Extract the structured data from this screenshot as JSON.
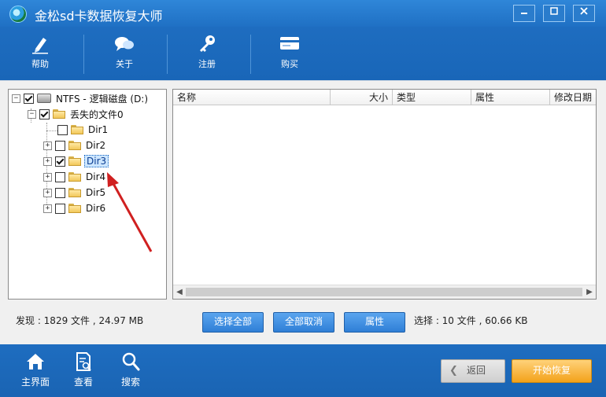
{
  "window": {
    "title": "金松sd卡数据恢复大师"
  },
  "toolbar": {
    "items": [
      {
        "label": "帮助"
      },
      {
        "label": "关于"
      },
      {
        "label": "注册"
      },
      {
        "label": "购买"
      }
    ]
  },
  "tree": {
    "root": {
      "label": "NTFS - 逻辑磁盘 (D:)",
      "checked": true
    },
    "lost": {
      "label": "丢失的文件0",
      "checked": true
    },
    "dirs": [
      {
        "label": "Dir1",
        "checked": false
      },
      {
        "label": "Dir2",
        "checked": false
      },
      {
        "label": "Dir3",
        "checked": true
      },
      {
        "label": "Dir4",
        "checked": false
      },
      {
        "label": "Dir5",
        "checked": false
      },
      {
        "label": "Dir6",
        "checked": false
      }
    ]
  },
  "list": {
    "columns": [
      "名称",
      "大小",
      "类型",
      "属性",
      "修改日期"
    ]
  },
  "status": {
    "found": "发现 : 1829 文件 , 24.97 MB",
    "selected": "选择 : 10 文件 , 60.66 KB"
  },
  "actions": {
    "select_all": "选择全部",
    "cancel_all": "全部取消",
    "properties": "属性"
  },
  "bottom": {
    "nav": [
      {
        "label": "主界面"
      },
      {
        "label": "查看"
      },
      {
        "label": "搜索"
      }
    ],
    "back": "返回",
    "recover": "开始恢复"
  },
  "colors": {
    "primary_blue": "#1e6dc0",
    "accent_orange": "#f3a21b",
    "annotation_red": "#d02020"
  }
}
